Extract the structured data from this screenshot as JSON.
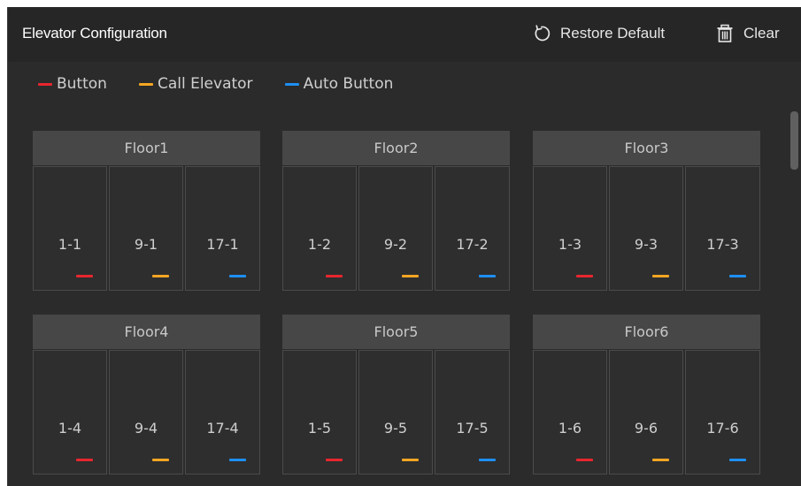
{
  "header": {
    "title": "Elevator Configuration",
    "restore_label": "Restore Default",
    "clear_label": "Clear"
  },
  "legend": [
    {
      "label": "Button",
      "color": "#e8262f"
    },
    {
      "label": "Call Elevator",
      "color": "#f5a623"
    },
    {
      "label": "Auto Button",
      "color": "#1e8ff2"
    }
  ],
  "floors": [
    {
      "title": "Floor1",
      "cells": [
        "1-1",
        "9-1",
        "17-1"
      ]
    },
    {
      "title": "Floor2",
      "cells": [
        "1-2",
        "9-2",
        "17-2"
      ]
    },
    {
      "title": "Floor3",
      "cells": [
        "1-3",
        "9-3",
        "17-3"
      ]
    },
    {
      "title": "Floor4",
      "cells": [
        "1-4",
        "9-4",
        "17-4"
      ]
    },
    {
      "title": "Floor5",
      "cells": [
        "1-5",
        "9-5",
        "17-5"
      ]
    },
    {
      "title": "Floor6",
      "cells": [
        "1-6",
        "9-6",
        "17-6"
      ]
    }
  ],
  "icons": {
    "restore": "restore-icon",
    "clear": "trash-icon"
  }
}
